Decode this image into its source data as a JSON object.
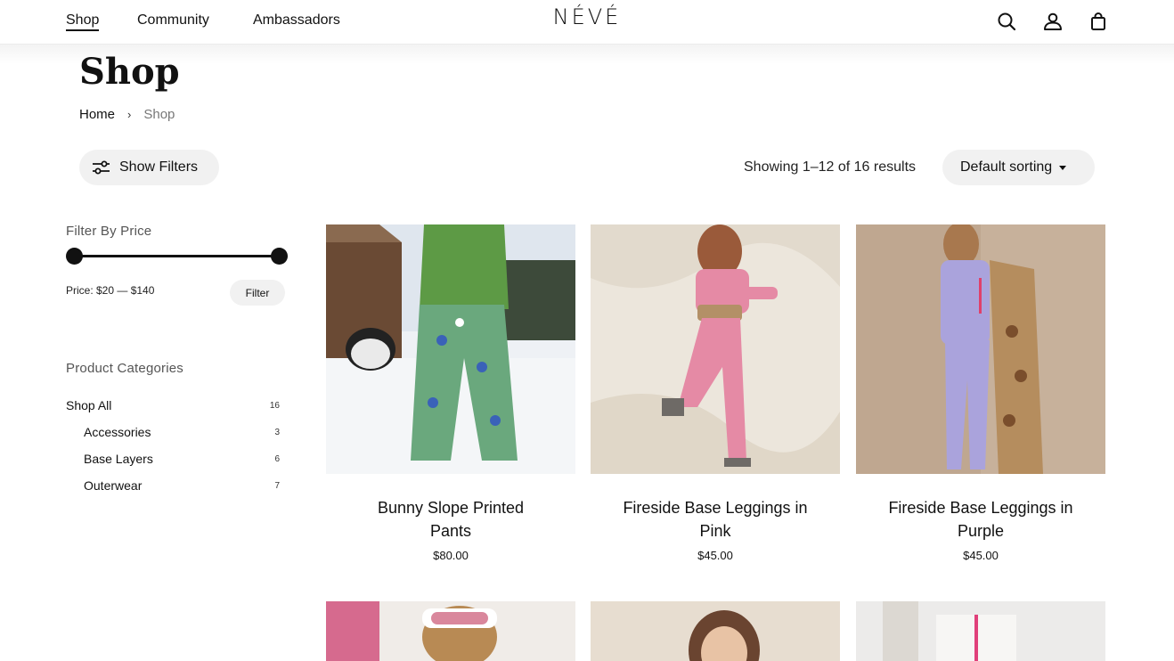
{
  "header": {
    "nav": [
      "Shop",
      "Community",
      "Ambassadors"
    ],
    "logo": "NÉVÉ",
    "icons": [
      "search-icon",
      "account-icon",
      "shopping-bag-icon"
    ]
  },
  "page": {
    "title": "Shop",
    "breadcrumb": {
      "home": "Home",
      "separator": "›",
      "current": "Shop"
    }
  },
  "toolbar": {
    "filters_label": "Show Filters",
    "results": "Showing 1–12 of 16 results",
    "sort_selected": "Default sorting"
  },
  "sidebar": {
    "price_heading": "Filter By Price",
    "price_range": {
      "min": 20,
      "max": 140
    },
    "price_text": "Price: $20 — $140",
    "filter_button": "Filter",
    "categories_heading": "Product Categories",
    "categories": [
      {
        "label": "Shop All",
        "count": "16"
      },
      {
        "label": "Accessories",
        "count": "3"
      },
      {
        "label": "Base Layers",
        "count": "6"
      },
      {
        "label": "Outerwear",
        "count": "7"
      }
    ]
  },
  "products": [
    {
      "name_line1": "Bunny Slope Printed",
      "name_line2": "Pants",
      "price": "$80.00"
    },
    {
      "name_line1": "Fireside Base Leggings in",
      "name_line2": "Pink",
      "price": "$45.00"
    },
    {
      "name_line1": "Fireside Base Leggings in",
      "name_line2": "Purple",
      "price": "$45.00"
    }
  ],
  "colors": {
    "text": "#111111",
    "pill_bg": "#f1f1f1",
    "muted": "#777777"
  }
}
